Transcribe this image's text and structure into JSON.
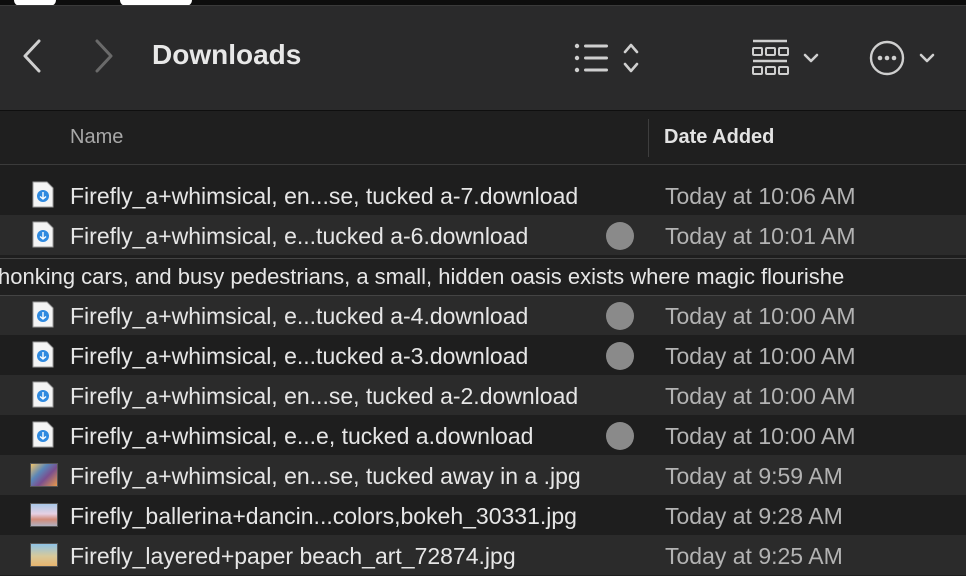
{
  "toolbar": {
    "title": "Downloads",
    "back_icon": "chevron-left-icon",
    "forward_icon": "chevron-right-icon",
    "view_list_icon": "list-icon",
    "sort_icon": "up-down-chevron-icon",
    "group_icon": "grid-icon",
    "more_icon": "ellipsis-circle-icon"
  },
  "columns": {
    "name": "Name",
    "date_added": "Date Added"
  },
  "rows": [
    {
      "name": "Firefly_a+whimsical, en...se, tucked a-7.download",
      "date": "Today at 10:06 AM",
      "icon": "download-file-icon",
      "tag": false
    },
    {
      "name": "Firefly_a+whimsical, e...tucked a-6.download",
      "date": "Today at 10:01 AM",
      "icon": "download-file-icon",
      "tag": true
    },
    {
      "name": "Firefly_a+whimsical, e...tucked a-4.download",
      "date": "Today at 10:00 AM",
      "icon": "download-file-icon",
      "tag": true
    },
    {
      "name": "Firefly_a+whimsical, e...tucked a-3.download",
      "date": "Today at 10:00 AM",
      "icon": "download-file-icon",
      "tag": true
    },
    {
      "name": "Firefly_a+whimsical, en...se, tucked a-2.download",
      "date": "Today at 10:00 AM",
      "icon": "download-file-icon",
      "tag": false
    },
    {
      "name": "Firefly_a+whimsical, e...e, tucked a.download",
      "date": "Today at 10:00 AM",
      "icon": "download-file-icon",
      "tag": true
    },
    {
      "name": "Firefly_a+whimsical, en...se, tucked away in a .jpg",
      "date": "Today at 9:59 AM",
      "icon": "image-thumbnail-icon",
      "tag": false
    },
    {
      "name": "Firefly_ballerina+dancin...colors,bokeh_30331.jpg",
      "date": "Today at 9:28 AM",
      "icon": "image-thumbnail-icon",
      "tag": false
    },
    {
      "name": "Firefly_layered+paper beach_art_72874.jpg",
      "date": "Today at 9:25 AM",
      "icon": "image-thumbnail-icon",
      "tag": false
    }
  ],
  "rename_overflow_text": "honking cars, and busy pedestrians, a small, hidden oasis exists where magic flourishe",
  "colors": {
    "window_bg": "#1e1e1e",
    "toolbar_bg": "#2a2a2b",
    "row_alt_bg": "#2b2b2b",
    "tag_gray": "#8a8a8a",
    "text": "#e6e6e6"
  }
}
